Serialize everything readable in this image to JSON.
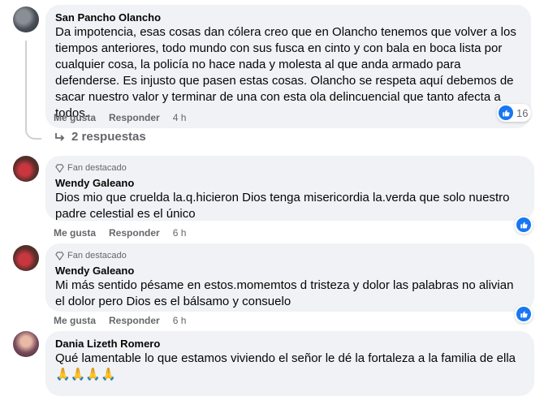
{
  "comments": [
    {
      "author": "San Pancho Olancho",
      "text": "Da impotencia, esas cosas dan cólera creo que en Olancho tenemos que volver a los tiempos anteriores, todo mundo con sus fusca en cinto y con bala en boca lista por cualquier cosa, la policía no hace nada y molesta al que anda armado para defenderse. Es injusto que pasen estas cosas. Olancho se respeta aquí debemos de sacar nuestro valor y terminar de una con esta ola delincuencial que tanto afecta a todos.",
      "like_label": "Me gusta",
      "reply_label": "Responder",
      "time": "4 h",
      "reaction_count": "16",
      "replies_label": "2 respuestas"
    },
    {
      "badge": "Fan destacado",
      "author": "Wendy Galeano",
      "text": "Dios mio que cruelda la.q.hicieron Dios tenga misericordia la.verda que solo nuestro padre celestial es el único",
      "like_label": "Me gusta",
      "reply_label": "Responder",
      "time": "6 h"
    },
    {
      "badge": "Fan destacado",
      "author": "Wendy Galeano",
      "text": "Mi más sentido pésame en estos.momemtos d tristeza y dolor las palabras no alivian el dolor pero Dios es el bálsamo y consuelo",
      "like_label": "Me gusta",
      "reply_label": "Responder",
      "time": "6 h"
    },
    {
      "author": "Dania Lizeth Romero",
      "text": "Qué lamentable lo que estamos viviendo el señor le dé la fortaleza a la familia de ella",
      "emoji": "🙏🙏🙏🙏"
    }
  ],
  "colors": {
    "like_blue": "#1877f2",
    "bubble": "#f0f2f5",
    "meta": "#65676b"
  }
}
